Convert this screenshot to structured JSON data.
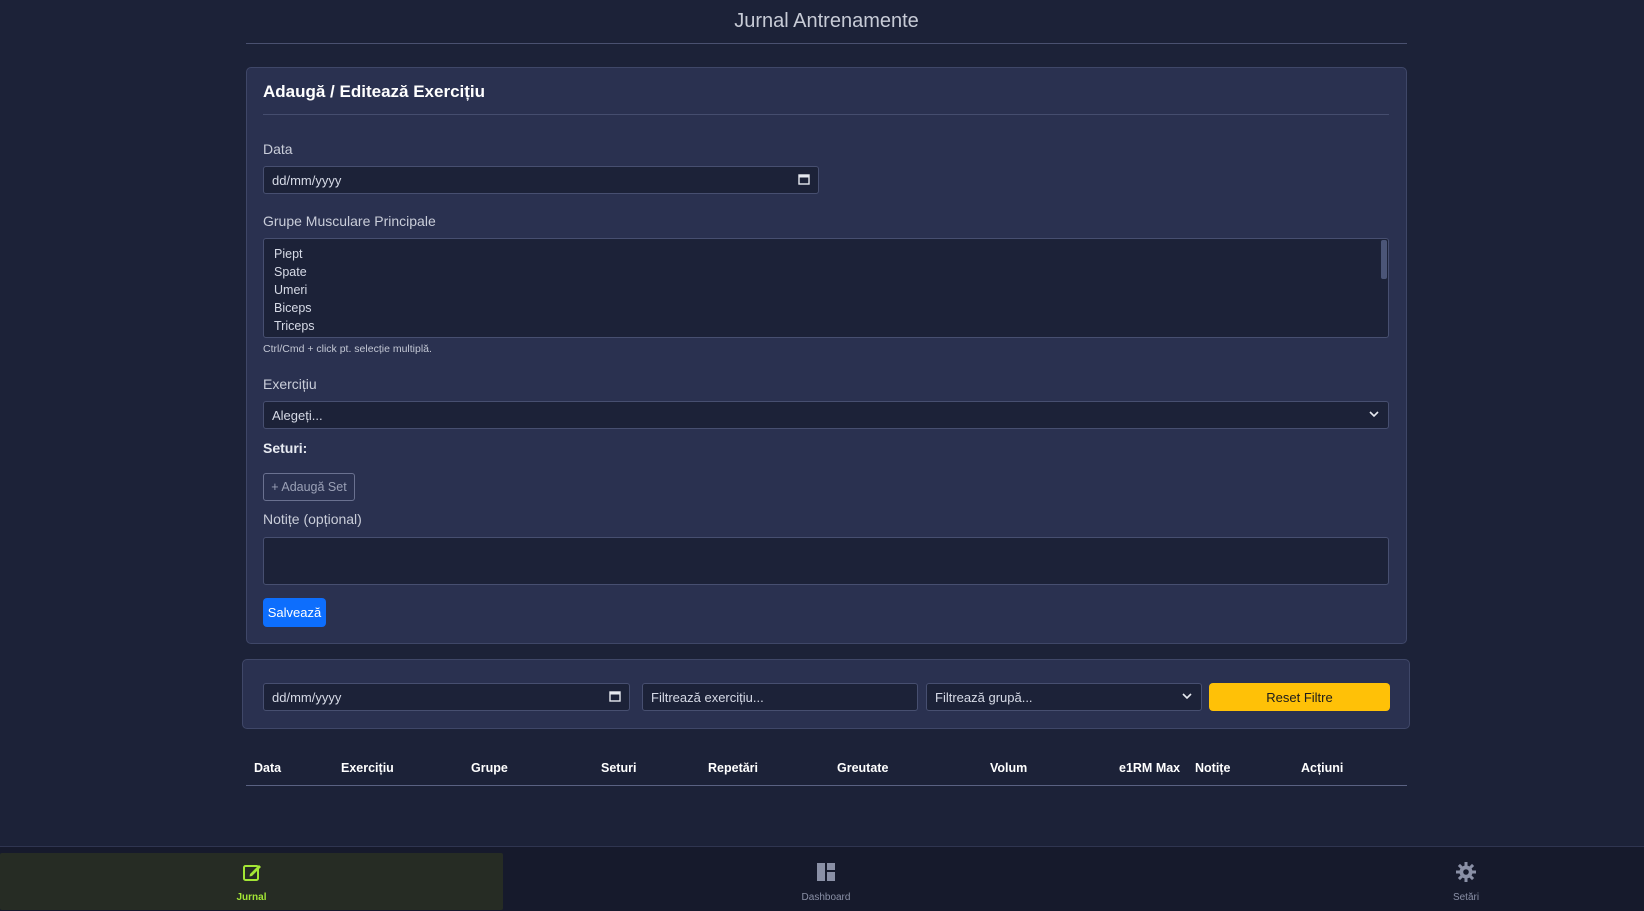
{
  "app": {
    "title": "Jurnal Antrenamente"
  },
  "form": {
    "title": "Adaugă / Editează Exercițiu",
    "date_label": "Data",
    "date_placeholder": "dd/mm/yyyy",
    "groups_label": "Grupe Musculare Principale",
    "groups_options": [
      "Piept",
      "Spate",
      "Umeri",
      "Biceps",
      "Triceps"
    ],
    "groups_hint": "Ctrl/Cmd + click pt. selecție multiplă.",
    "exercise_label": "Exercițiu",
    "exercise_selected": "Alegeți...",
    "sets_label": "Seturi:",
    "add_set_button": "+ Adaugă Set",
    "notes_label": "Notițe (opțional)",
    "notes_value": "",
    "save_button": "Salvează"
  },
  "filters": {
    "date_placeholder": "dd/mm/yyyy",
    "exercise_placeholder": "Filtrează exercițiu...",
    "group_selected": "Filtrează grupă...",
    "reset_button": "Reset Filtre"
  },
  "table": {
    "columns": [
      "Data",
      "Exercițiu",
      "Grupe",
      "Seturi",
      "Repetări",
      "Greutate",
      "Volum",
      "e1RM Max",
      "Notițe",
      "Acțiuni"
    ],
    "rows": []
  },
  "nav": {
    "items": [
      {
        "label": "Jurnal",
        "icon": "edit-icon",
        "active": true
      },
      {
        "label": "Dashboard",
        "icon": "dashboard-icon",
        "active": false
      },
      {
        "label": "Setări",
        "icon": "gear-icon",
        "active": false
      }
    ]
  },
  "colors": {
    "background": "#1c2238",
    "card": "#2a3150",
    "primary": "#0d6efd",
    "warning": "#ffc107",
    "nav_active": "#a3e635"
  }
}
